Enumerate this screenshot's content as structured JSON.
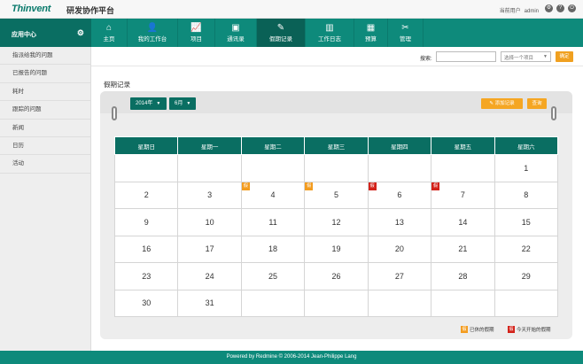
{
  "app": {
    "logo": "Thinvent",
    "subtitle": "研发协作平台"
  },
  "user": {
    "label": "当前用户",
    "name": "admin"
  },
  "top_icons": [
    "⚙",
    "?",
    "⏻"
  ],
  "nav": {
    "app_center": "应用中心",
    "items": [
      {
        "label": "主页",
        "icon": "⌂"
      },
      {
        "label": "我的工作台",
        "icon": "👤"
      },
      {
        "label": "项目",
        "icon": "📈"
      },
      {
        "label": "通讯录",
        "icon": "▣"
      },
      {
        "label": "假期记录",
        "icon": "✎"
      },
      {
        "label": "工作日志",
        "icon": "▥"
      },
      {
        "label": "预算",
        "icon": "▦"
      },
      {
        "label": "管理",
        "icon": "✂"
      }
    ]
  },
  "sidebar": {
    "items": [
      "指派给我的问题",
      "已报告的问题",
      "耗时",
      "跟踪的问题",
      "新闻",
      "日历",
      "活动"
    ]
  },
  "filter": {
    "search_label": "搜索:",
    "search_value": "",
    "project_select": "选择一个项目",
    "ok": "确定"
  },
  "main": {
    "title": "假期记录",
    "year": "2014年",
    "month": "6月",
    "add_btn": "添加记录",
    "query_btn": "查询"
  },
  "calendar": {
    "weekdays": [
      "星期日",
      "星期一",
      "星期二",
      "星期三",
      "星期四",
      "星期五",
      "星期六"
    ],
    "weeks": [
      [
        "",
        "",
        "",
        "",
        "",
        "",
        "1"
      ],
      [
        "2",
        "3",
        "4",
        "5",
        "6",
        "7",
        "8"
      ],
      [
        "9",
        "10",
        "11",
        "12",
        "13",
        "14",
        "15"
      ],
      [
        "16",
        "17",
        "18",
        "19",
        "20",
        "21",
        "22"
      ],
      [
        "23",
        "24",
        "25",
        "26",
        "27",
        "28",
        "29"
      ],
      [
        "30",
        "31",
        "",
        "",
        "",
        "",
        ""
      ]
    ],
    "badge_text": "假",
    "badges": {
      "4": "orange",
      "5": "orange",
      "6": "red",
      "7": "red"
    }
  },
  "legend": {
    "past": "已休的假期",
    "today": "今天开始的假期"
  },
  "colors": {
    "primary": "#0e8a7b",
    "dark": "#0a6e62",
    "orange": "#f39c1f",
    "red": "#d3221a"
  },
  "footer": "Powered by Redmine © 2006-2014 Jean-Philippe Lang"
}
